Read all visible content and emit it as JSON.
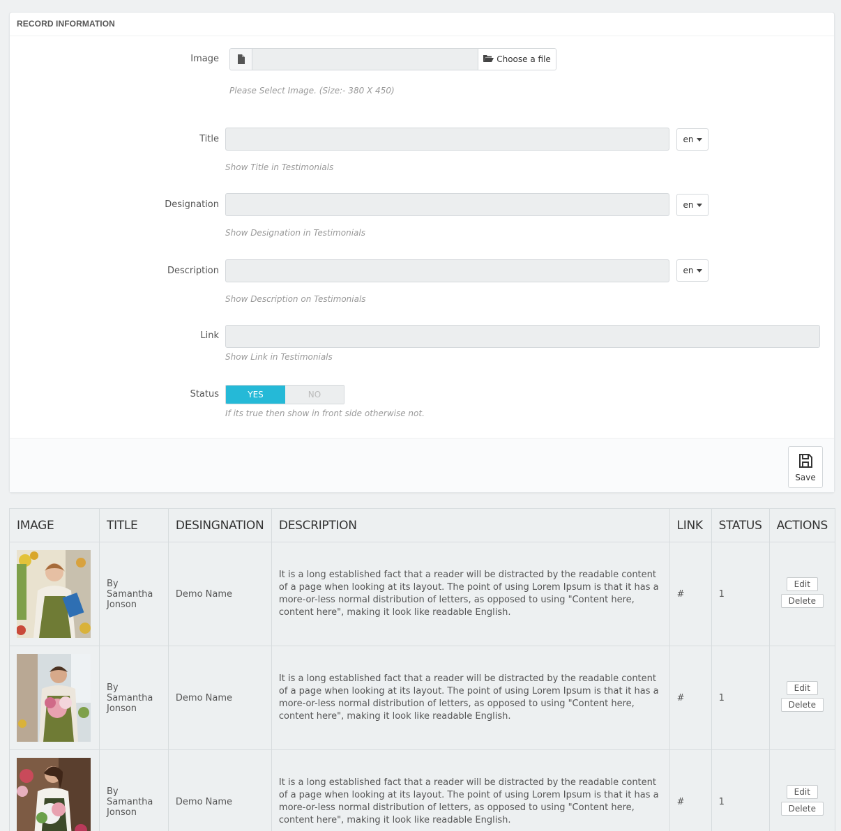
{
  "panel": {
    "heading": "RECORD INFORMATION"
  },
  "form": {
    "image": {
      "label": "Image",
      "button_label": "Choose a file",
      "help": "Please Select Image. (Size:- 380 X 450)"
    },
    "title": {
      "label": "Title",
      "lang": "en",
      "help": "Show Title in Testimonials"
    },
    "designation": {
      "label": "Designation",
      "lang": "en",
      "help": "Show Designation in Testimonials"
    },
    "description": {
      "label": "Description",
      "lang": "en",
      "help": "Show Description on Testimonials"
    },
    "link": {
      "label": "Link",
      "help": "Show Link in Testimonials"
    },
    "status": {
      "label": "Status",
      "yes": "YES",
      "no": "NO",
      "selected": "YES",
      "help": "If its true then show in front side otherwise not."
    },
    "save_label": "Save"
  },
  "table": {
    "headers": [
      "IMAGE",
      "TITLE",
      "DESINGNATION",
      "DESCRIPTION",
      "LINK",
      "STATUS",
      "ACTIONS"
    ],
    "rows": [
      {
        "title": "By Samantha Jonson",
        "designation": "Demo Name",
        "description": "It is a long established fact that a reader will be distracted by the readable content of a page when looking at its layout. The point of using Lorem Ipsum is that it has a more-or-less normal distribution of letters, as opposed to using \"Content here, content here\", making it look like readable English.",
        "link": "#",
        "status": "1",
        "edit": "Edit",
        "delete": "Delete"
      },
      {
        "title": "By Samantha Jonson",
        "designation": "Demo Name",
        "description": "It is a long established fact that a reader will be distracted by the readable content of a page when looking at its layout. The point of using Lorem Ipsum is that it has a more-or-less normal distribution of letters, as opposed to using \"Content here, content here\", making it look like readable English.",
        "link": "#",
        "status": "1",
        "edit": "Edit",
        "delete": "Delete"
      },
      {
        "title": "By Samantha Jonson",
        "designation": "Demo Name",
        "description": "It is a long established fact that a reader will be distracted by the readable content of a page when looking at its layout. The point of using Lorem Ipsum is that it has a more-or-less normal distribution of letters, as opposed to using \"Content here, content here\", making it look like readable English.",
        "link": "#",
        "status": "1",
        "edit": "Edit",
        "delete": "Delete"
      }
    ]
  },
  "colors": {
    "accent": "#25b9d7",
    "background": "#eff1f2"
  }
}
